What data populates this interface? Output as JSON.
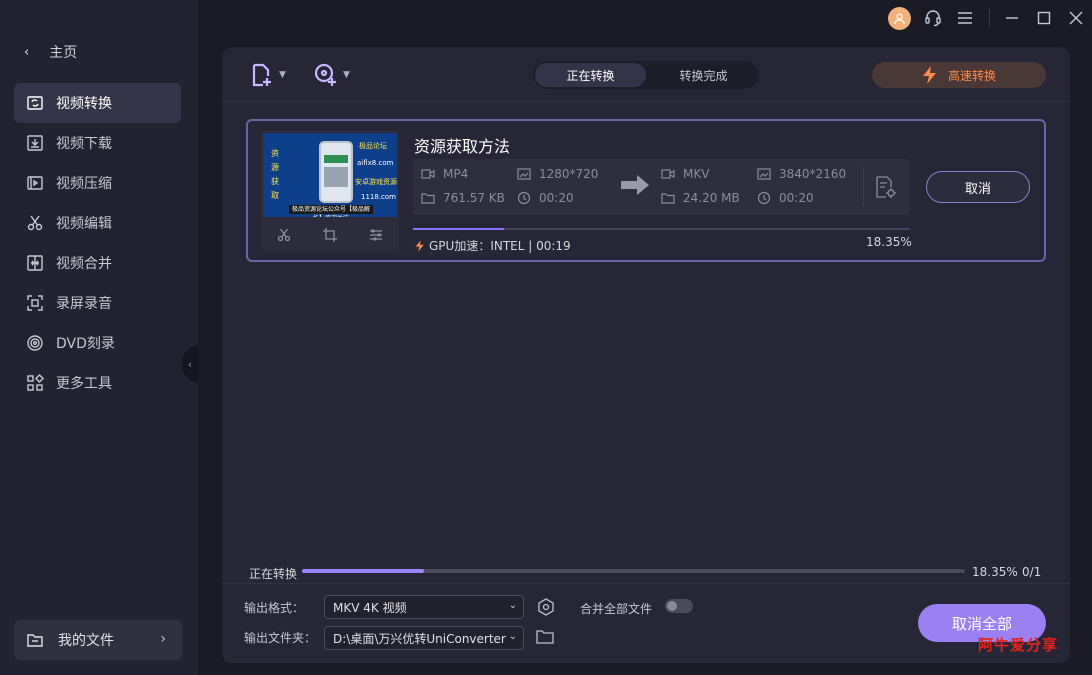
{
  "sidebar": {
    "home_label": "主页",
    "items": [
      {
        "label": "视频转换",
        "icon": "video-convert-icon",
        "active": true
      },
      {
        "label": "视频下载",
        "icon": "download-icon"
      },
      {
        "label": "视频压缩",
        "icon": "compress-icon"
      },
      {
        "label": "视频编辑",
        "icon": "scissors-icon"
      },
      {
        "label": "视频合并",
        "icon": "merge-icon"
      },
      {
        "label": "录屏录音",
        "icon": "screen-record-icon"
      },
      {
        "label": "DVD刻录",
        "icon": "disc-icon"
      },
      {
        "label": "更多工具",
        "icon": "grid-tools-icon"
      }
    ],
    "my_files_label": "我的文件"
  },
  "toolbar": {
    "tabs": [
      "正在转换",
      "转换完成"
    ],
    "active_tab": "正在转换",
    "speed_label": "高速转换"
  },
  "task": {
    "filename": "资源获取方法",
    "thumbnail_text": {
      "left": "资源获取",
      "right1": "极品论坛",
      "right2": "aiflx8.com",
      "right3": "安卓游戏资源",
      "right4": "1118.com",
      "bottom": "极品资源论坛公众号【极品解析】欢迎关注"
    },
    "source": {
      "format": "MP4",
      "resolution": "1280*720",
      "size": "761.57 KB",
      "duration": "00:20"
    },
    "target": {
      "format": "MKV",
      "resolution": "3840*2160",
      "size": "24.20 MB",
      "duration": "00:20"
    },
    "cancel_label": "取消",
    "progress_percent": 18.35,
    "progress_text": "18.35%",
    "gpu_text": "GPU加速：INTEL | 00:19"
  },
  "overall": {
    "label": "正在转换",
    "progress_percent": 18.35,
    "progress_text": "18.35%",
    "count_text": "0/1"
  },
  "bottom": {
    "format_label": "输出格式：",
    "format_value": "MKV 4K 视频",
    "merge_label": "合并全部文件",
    "merge_on": false,
    "folder_label": "输出文件夹：",
    "folder_value": "D:\\桌面\\万兴优转UniConverter",
    "cancel_all_label": "取消全部"
  },
  "watermark": "阿牛爱分享",
  "colors": {
    "accent": "#9b80f2",
    "speed": "#ff8a4a",
    "watermark": "#e3231c"
  }
}
